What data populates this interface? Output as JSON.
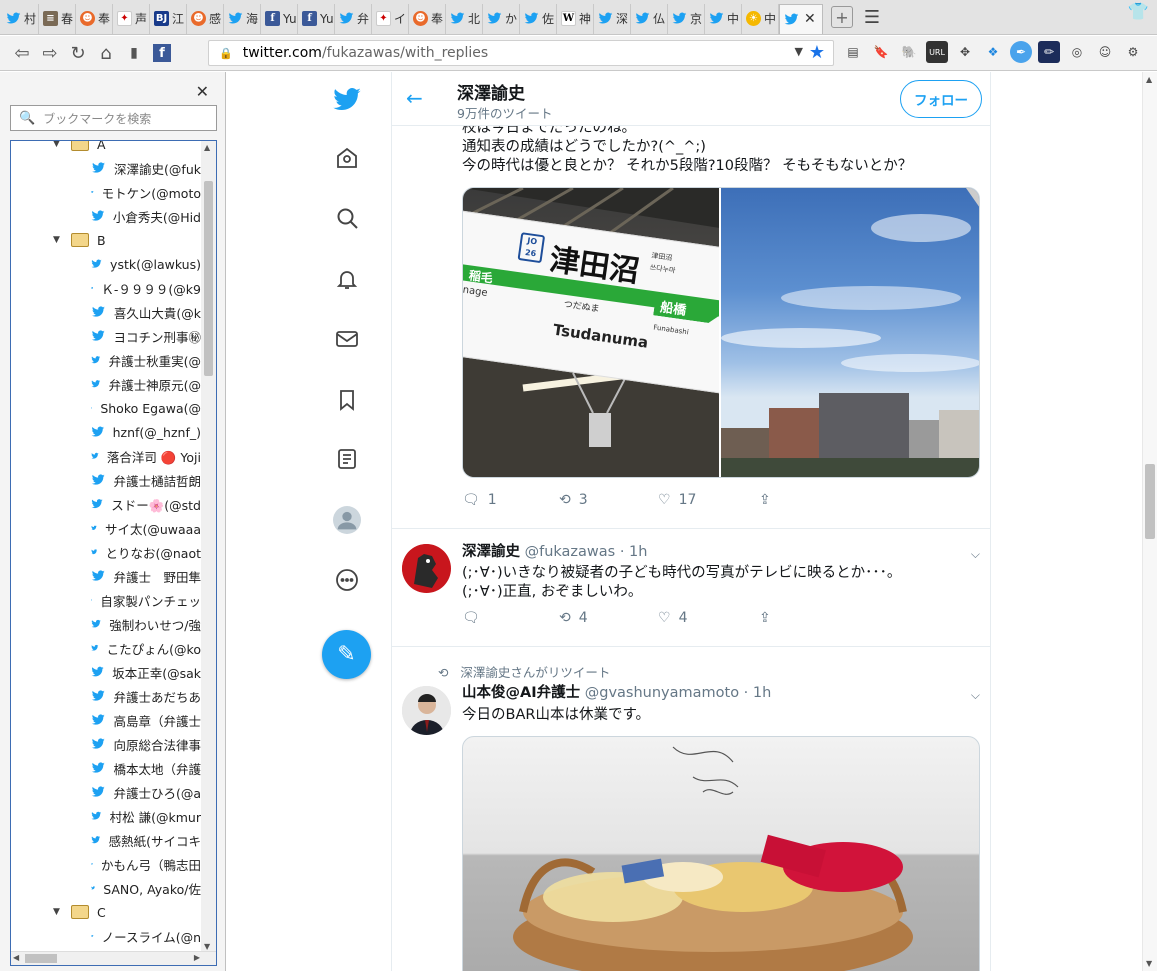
{
  "tabs": [
    {
      "icon": "twitter-icon",
      "title": "村"
    },
    {
      "icon": "book-icon",
      "title": "春"
    },
    {
      "icon": "cat-icon",
      "title": "奉"
    },
    {
      "icon": "red-icon",
      "title": "声"
    },
    {
      "icon": "bj-icon",
      "title": "江",
      "badge": "BJ"
    },
    {
      "icon": "cat-icon",
      "title": "感"
    },
    {
      "icon": "twitter-icon",
      "title": "海"
    },
    {
      "icon": "facebook-icon",
      "title": "Yu"
    },
    {
      "icon": "facebook-icon",
      "title": "Yu"
    },
    {
      "icon": "twitter-icon",
      "title": "弁"
    },
    {
      "icon": "red-icon",
      "title": "イ"
    },
    {
      "icon": "cat-icon",
      "title": "奉"
    },
    {
      "icon": "twitter-icon",
      "title": "北"
    },
    {
      "icon": "twitter-icon",
      "title": "か"
    },
    {
      "icon": "twitter-icon",
      "title": "佐"
    },
    {
      "icon": "wikipedia-icon",
      "title": "神",
      "badge": "W"
    },
    {
      "icon": "twitter-icon",
      "title": "深"
    },
    {
      "icon": "twitter-icon",
      "title": "仏"
    },
    {
      "icon": "twitter-icon",
      "title": "京"
    },
    {
      "icon": "twitter-icon",
      "title": "中"
    },
    {
      "icon": "sun-icon",
      "title": "中"
    }
  ],
  "active_tab": {
    "icon": "twitter-icon",
    "close": "✕"
  },
  "address_bar": {
    "host": "twitter.com",
    "path": "/fukazawas/with_replies"
  },
  "toolbar_icons": [
    "bookmarks-manager-icon",
    "bookmark-icon",
    "evernote-icon",
    "url-icon",
    "crosshair-icon",
    "dropbox-icon",
    "feather-icon",
    "pencil-icon",
    "gauge-icon",
    "avatar-icon",
    "extensions-icon"
  ],
  "sidebar": {
    "search_placeholder": "ブックマークを検索",
    "close": "✕",
    "tree": [
      {
        "type": "folder",
        "label": "A"
      },
      {
        "type": "bookmark",
        "label": "深澤諭史(@fuk"
      },
      {
        "type": "bookmark",
        "label": "モトケン(@moto"
      },
      {
        "type": "bookmark",
        "label": "小倉秀夫(@Hid"
      },
      {
        "type": "folder",
        "label": "B"
      },
      {
        "type": "bookmark",
        "label": "ystk(@lawkus)"
      },
      {
        "type": "bookmark",
        "label": "Ｋ-９９９９(@k9"
      },
      {
        "type": "bookmark",
        "label": "喜久山大貴(@k"
      },
      {
        "type": "bookmark",
        "label": "ヨコチン刑事㊙︎"
      },
      {
        "type": "bookmark",
        "label": "弁護士秋重実(@"
      },
      {
        "type": "bookmark",
        "label": "弁護士神原元(@"
      },
      {
        "type": "bookmark",
        "label": "Shoko Egawa(@"
      },
      {
        "type": "bookmark",
        "label": "hznf(@_hznf_)"
      },
      {
        "type": "bookmark",
        "label": "落合洋司 🔴 Yoji"
      },
      {
        "type": "bookmark",
        "label": "弁護士樋詰哲朗"
      },
      {
        "type": "bookmark",
        "label": "スドー🌸(@std"
      },
      {
        "type": "bookmark",
        "label": "サイ太(@uwaaa"
      },
      {
        "type": "bookmark",
        "label": "とりなお(@naot"
      },
      {
        "type": "bookmark",
        "label": "弁護士　野田隼"
      },
      {
        "type": "bookmark",
        "label": "自家製パンチェッ"
      },
      {
        "type": "bookmark",
        "label": "強制わいせつ/強"
      },
      {
        "type": "bookmark",
        "label": "こたぴょん(@ko"
      },
      {
        "type": "bookmark",
        "label": "坂本正幸(@sak"
      },
      {
        "type": "bookmark",
        "label": "弁護士あだちあ"
      },
      {
        "type": "bookmark",
        "label": "高島章（弁護士"
      },
      {
        "type": "bookmark",
        "label": "向原総合法律事"
      },
      {
        "type": "bookmark",
        "label": "橋本太地（弁護"
      },
      {
        "type": "bookmark",
        "label": "弁護士ひろ(@a"
      },
      {
        "type": "bookmark",
        "label": "村松 謙(@kmur"
      },
      {
        "type": "bookmark",
        "label": "感熱紙(サイコキ"
      },
      {
        "type": "bookmark",
        "label": "かもん弓（鴨志田"
      },
      {
        "type": "bookmark",
        "label": "SANO, Ayako/佐"
      },
      {
        "type": "folder",
        "label": "C"
      },
      {
        "type": "bookmark",
        "label": "ノースライム(@n"
      }
    ]
  },
  "profile_header": {
    "name": "深澤諭史",
    "tweet_count": "9万件のツイート",
    "follow_label": "フォロー"
  },
  "tweets": [
    {
      "text_lines": [
        "校は今日までだったのね。",
        "通知表の成績はどうでしたか?(^_^;)",
        "今の時代は優と良とか？ それか5段階?10段階？ そもそもないとか？"
      ],
      "photos": [
        {
          "sign_main": "津田沼",
          "sign_kana": "つだぬま",
          "sign_roman": "Tsudanuma",
          "sign_left": "稲毛",
          "sign_left_roman": "nage",
          "sign_right": "船橋",
          "sign_right_roman": "Funabashi",
          "sign_code_line": "JO",
          "sign_code_num": "26",
          "sign_small_1": "津田沼",
          "sign_small_2": "쓰다누마"
        },
        {
          "label": "sky-photo"
        }
      ],
      "replies": "1",
      "retweets": "3",
      "likes": "17"
    },
    {
      "name": "深澤諭史",
      "handle": "@fukazawas",
      "time": "· 1h",
      "text_lines": [
        "(;･∀･)いきなり被疑者の子ども時代の写真がテレビに映るとか･･･。",
        "(;･∀･)正直, おぞましいわ。"
      ],
      "replies": "",
      "retweets": "4",
      "likes": "4"
    },
    {
      "retweet_note": "深澤諭史さんがリツイート",
      "name": "山本俊@AI弁護士",
      "handle": "@gvashunyamamoto",
      "time": "· 1h",
      "text_lines": [
        "今日のBAR山本は休業です。"
      ]
    }
  ]
}
